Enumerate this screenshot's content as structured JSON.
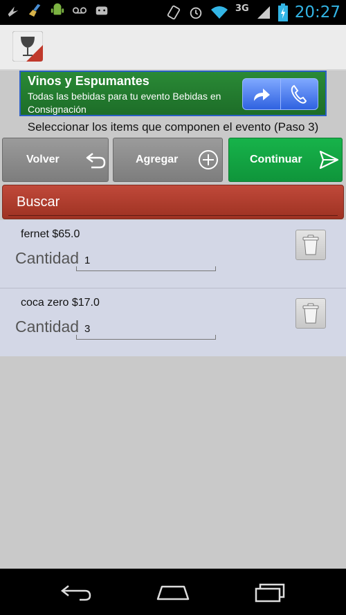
{
  "status_bar": {
    "time": "20:27",
    "network": "3G",
    "icons": [
      "lightning-icon",
      "broom-icon",
      "android-icon",
      "voicemail-icon",
      "gamepad-icon",
      "rotate-icon",
      "alarm-icon",
      "wifi-icon",
      "signal-icon",
      "battery-charging-icon"
    ]
  },
  "action_bar": {
    "app_icon": "wine-glass-icon"
  },
  "banner": {
    "title": "Vinos y Espumantes",
    "subtitle": "Todas las bebidas para tu evento Bebidas en Consignación",
    "icons": [
      "share-arrow-icon",
      "phone-icon"
    ]
  },
  "instructions": "Seleccionar los items que componen el evento (Paso 3)",
  "buttons": {
    "back": "Volver",
    "add": "Agregar",
    "continue": "Continuar"
  },
  "search": {
    "label": "Buscar"
  },
  "items": [
    {
      "name": "fernet $65.0",
      "quantity_label": "Cantidad",
      "quantity": "1"
    },
    {
      "name": "coca zero $17.0",
      "quantity_label": "Cantidad",
      "quantity": "3"
    }
  ],
  "colors": {
    "accent_green": "#12a443",
    "search_red": "#b03e2e",
    "status_blue": "#33b5e5",
    "list_bg": "#d3d7e6"
  }
}
